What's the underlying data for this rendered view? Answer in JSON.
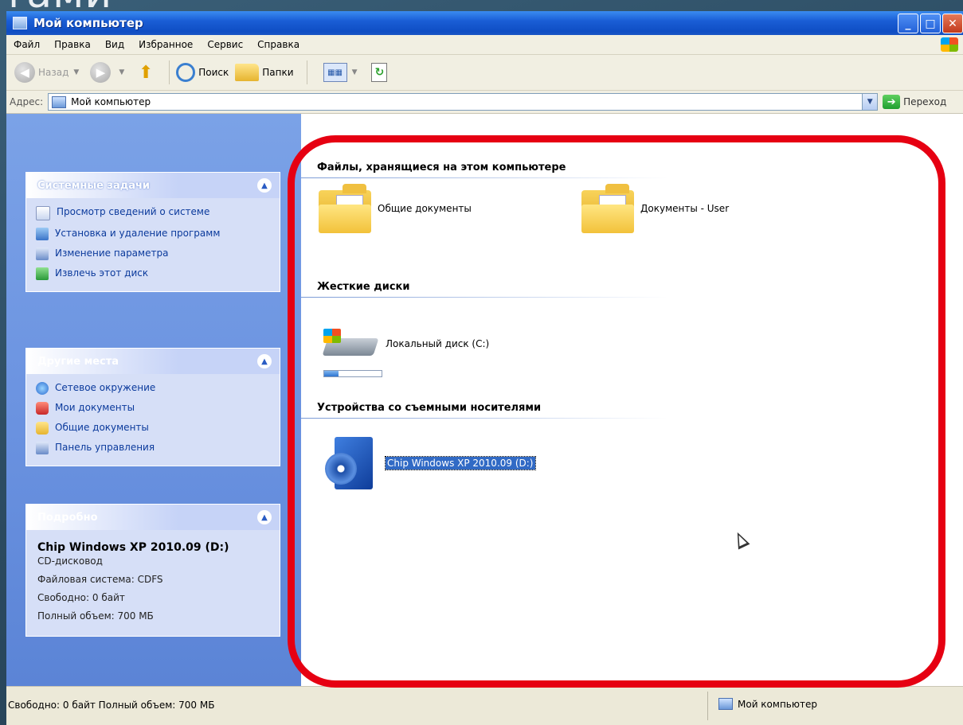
{
  "slide": {
    "caption_fragment": "тами"
  },
  "window": {
    "title": "Мой компьютер",
    "buttons": {
      "minimize": "_",
      "maximize": "□",
      "close": "✕"
    }
  },
  "menu": {
    "items": [
      "Файл",
      "Правка",
      "Вид",
      "Избранное",
      "Сервис",
      "Справка"
    ]
  },
  "toolbar": {
    "back_label": "Назад",
    "search_label": "Поиск",
    "folders_label": "Папки"
  },
  "address": {
    "label": "Адрес:",
    "value": "Мой компьютер",
    "go_label": "Переход"
  },
  "left": {
    "system_tasks": {
      "title": "Системные задачи",
      "items": [
        "Просмотр сведений о системе",
        "Установка и удаление программ",
        "Изменение параметра",
        "Извлечь этот диск"
      ]
    },
    "other_places": {
      "title": "Другие места",
      "items": [
        "Сетевое окружение",
        "Мои документы",
        "Общие документы",
        "Панель управления"
      ]
    },
    "details": {
      "title": "Подробно",
      "name": "Chip Windows XP 2010.09 (D:)",
      "type": "CD-дисковод",
      "filesystem": "Файловая система: CDFS",
      "free": "Свободно: 0 байт",
      "total": "Полный объем: 700 МБ"
    }
  },
  "right": {
    "group_files": {
      "title": "Файлы, хранящиеся на этом компьютере",
      "items": [
        "Общие документы",
        "Документы - User"
      ]
    },
    "group_drives": {
      "title": "Жесткие диски",
      "items": [
        "Локальный диск (C:)"
      ],
      "usage_fraction": 0.25
    },
    "group_removable": {
      "title": "Устройства со съемными носителями",
      "items": [
        "Chip Windows XP 2010.09 (D:)"
      ]
    }
  },
  "status": {
    "left_text": "Свободно: 0 байт Полный объем: 700 МБ",
    "right_text": "Мой компьютер"
  },
  "colors": {
    "highlight_frame": "#e60012",
    "selection": "#316ac5",
    "xp_blue": "#0f4ec4"
  }
}
